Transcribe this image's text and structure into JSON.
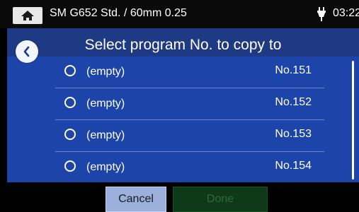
{
  "status_bar": {
    "title": "SM G652 Std. / 60mm 0.25",
    "time": "03:22",
    "home_icon": "home-icon",
    "power_icon": "plug-icon"
  },
  "header": {
    "title": "Select program No. to copy to",
    "back_icon": "chevron-left-icon"
  },
  "list": {
    "items": [
      {
        "label": "(empty)",
        "number": "No.151",
        "selected": false
      },
      {
        "label": "(empty)",
        "number": "No.152",
        "selected": false
      },
      {
        "label": "(empty)",
        "number": "No.153",
        "selected": false
      },
      {
        "label": "(empty)",
        "number": "No.154",
        "selected": false
      }
    ]
  },
  "buttons": {
    "cancel_label": "Cancel",
    "done_label": "Done",
    "done_enabled": false
  },
  "colors": {
    "header_bg": "#1e3a84",
    "list_bg": "#1d44a8",
    "cancel_bg": "#9bb0dc",
    "done_bg": "#0f3a18"
  }
}
